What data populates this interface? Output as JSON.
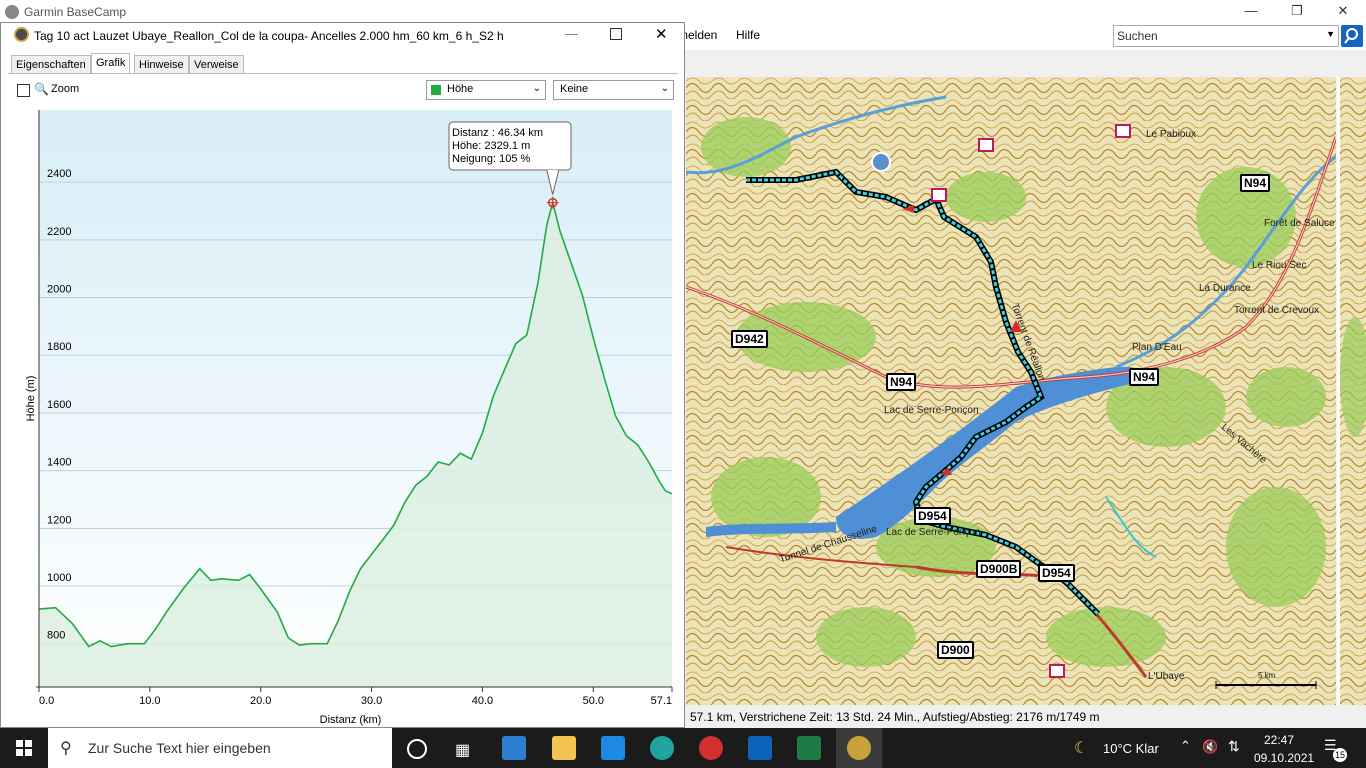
{
  "app": {
    "title": "Garmin BaseCamp",
    "menu": [
      "melden",
      "Hilfe"
    ],
    "search_placeholder": "Suchen"
  },
  "dialog": {
    "title": "Tag 10 act Lauzet Ubaye_Reallon_Col de la coupa- Ancelles 2.000 hm_60 km_6 h_S2 h",
    "tabs": [
      "Eigenschaften",
      "Grafik",
      "Hinweise",
      "Verweise"
    ],
    "active_tab": "Grafik",
    "zoom_label": "Zoom",
    "series_select": "Höhe",
    "secondary_select": "Keine",
    "series_color": "#22aa44"
  },
  "tooltip": {
    "line1": "Distanz : 46.34 km",
    "line2": "Höhe: 2329.1 m",
    "line3": "Neigung: 105 %"
  },
  "chart_data": {
    "type": "area",
    "xlabel": "Distanz  (km)",
    "ylabel": "Höhe (m)",
    "xlim": [
      0,
      57.1
    ],
    "ylim": [
      650,
      2650
    ],
    "xticks": [
      "0.0",
      "10.0",
      "20.0",
      "30.0",
      "40.0",
      "50.0",
      "57.1"
    ],
    "xtick_values": [
      0,
      10,
      20,
      30,
      40,
      50,
      57.1
    ],
    "yticks": [
      "800",
      "1000",
      "1200",
      "1400",
      "1600",
      "1800",
      "2000",
      "2200",
      "2400"
    ],
    "ytick_values": [
      800,
      1000,
      1200,
      1400,
      1600,
      1800,
      2000,
      2200,
      2400
    ],
    "series": [
      {
        "x": [
          0,
          1.5,
          3,
          4.5,
          5.5,
          6.5,
          8,
          9.5,
          10.5,
          11.5,
          13,
          14.5,
          15.5,
          16.5,
          18,
          19,
          20,
          21.5,
          22.5,
          23.5,
          24.5,
          26,
          27,
          28,
          29,
          30,
          31,
          32,
          33,
          34,
          35,
          36,
          37,
          38,
          39,
          40,
          41,
          42,
          43,
          44,
          45,
          45.8,
          46.34,
          47,
          48,
          49,
          50,
          51,
          52,
          53,
          54,
          55,
          56,
          56.5,
          57.1
        ],
        "y": [
          920,
          925,
          870,
          790,
          810,
          790,
          800,
          800,
          850,
          910,
          990,
          1060,
          1020,
          1025,
          1020,
          1040,
          990,
          910,
          820,
          795,
          800,
          800,
          880,
          980,
          1060,
          1110,
          1160,
          1210,
          1290,
          1350,
          1380,
          1430,
          1420,
          1460,
          1440,
          1530,
          1660,
          1750,
          1840,
          1870,
          2050,
          2250,
          2329,
          2230,
          2120,
          2010,
          1860,
          1720,
          1590,
          1520,
          1490,
          1430,
          1360,
          1330,
          1320
        ]
      }
    ],
    "marker": {
      "x": 46.34,
      "y": 2329.1
    },
    "grid": true
  },
  "map": {
    "labels": [
      "Le Pabioux",
      "Forêt de Saluce",
      "Le Riou Sec",
      "La Durance",
      "Torrent de Crevoux",
      "Plan D'Eau",
      "Torrent de Réallon",
      "Lac de Serre-Ponçon",
      "Les Vachère",
      "Tunnel de Chausseline",
      "Lac de Serre-Ponçon",
      "L'Ubaye",
      "5 km"
    ],
    "shields": [
      "N94",
      "D942",
      "N94",
      "N94",
      "D954",
      "D900B",
      "D954",
      "D900"
    ]
  },
  "status": "57.1 km, Verstrichene Zeit: 13 Std. 24 Min., Aufstieg/Abstieg: 2176 m/1749 m",
  "taskbar": {
    "search_text": "Zur Suche Text hier eingeben",
    "weather": "10°C  Klar",
    "time": "22:47",
    "date": "09.10.2021",
    "notifications": "15"
  }
}
